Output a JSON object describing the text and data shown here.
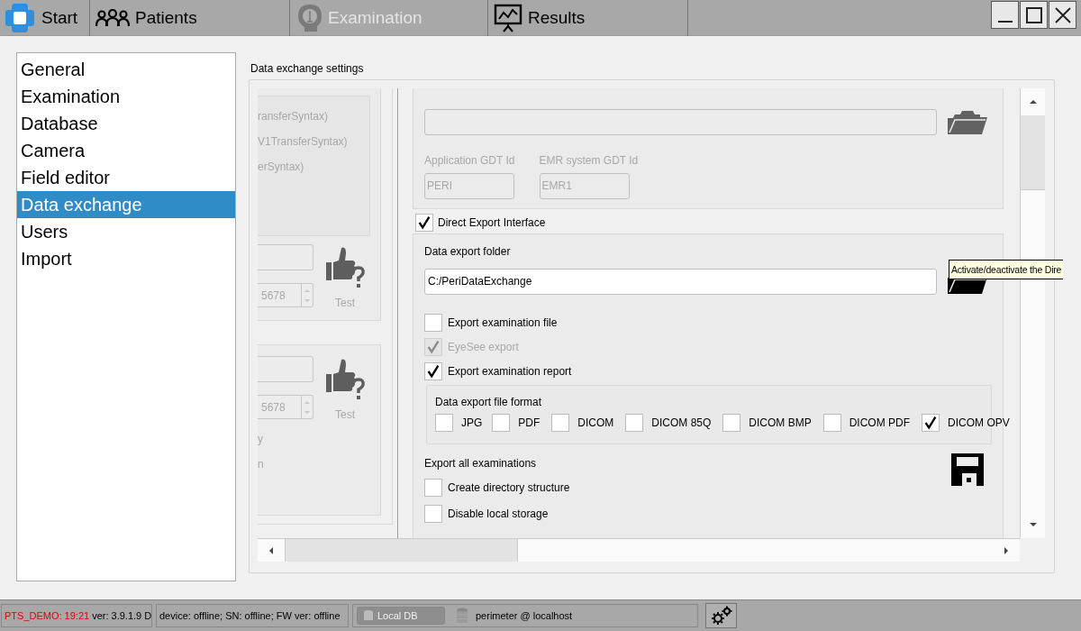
{
  "tabs": [
    {
      "label": "Start",
      "kind": "start",
      "disabled": false
    },
    {
      "label": "Patients",
      "kind": "patients",
      "disabled": false
    },
    {
      "label": "Examination",
      "kind": "examination",
      "disabled": true
    },
    {
      "label": "Results",
      "kind": "results",
      "disabled": false
    }
  ],
  "sidebar": {
    "items": [
      {
        "label": "General",
        "selected": false
      },
      {
        "label": "Examination",
        "selected": false
      },
      {
        "label": "Database",
        "selected": false
      },
      {
        "label": "Camera",
        "selected": false
      },
      {
        "label": "Field editor",
        "selected": false
      },
      {
        "label": "Data exchange",
        "selected": true
      },
      {
        "label": "Users",
        "selected": false
      },
      {
        "label": "Import",
        "selected": false
      }
    ]
  },
  "settings": {
    "title": "Data exchange settings",
    "left_panel": {
      "syntax_lines": [
        "ransferSyntax)",
        "V1TransferSyntax)",
        "erSyntax)"
      ],
      "connections": [
        {
          "port": "5678",
          "test": "Test"
        },
        {
          "port": "5678",
          "test": "Test",
          "extra": [
            "y",
            "n"
          ]
        }
      ]
    },
    "gdt": {
      "app_label": "Application GDT Id",
      "app_id": "PERI",
      "emr_label": "EMR system GDT Id",
      "emr_id": "EMR1"
    },
    "direct_export": {
      "label": "Direct Export Interface",
      "checked": true
    },
    "export_folder_label": "Data export folder",
    "export_folder": "C:/PeriDataExchange",
    "options": [
      {
        "label": "Export examination file",
        "checked": false,
        "disabled": false
      },
      {
        "label": "EyeSee export",
        "checked": true,
        "disabled": true
      },
      {
        "label": "Export examination report",
        "checked": true,
        "disabled": false
      }
    ],
    "format_group": {
      "title": "Data export file format",
      "formats": [
        {
          "label": "JPG",
          "checked": false
        },
        {
          "label": "PDF",
          "checked": false
        },
        {
          "label": "DICOM",
          "checked": false
        },
        {
          "label": "DICOM 85Q",
          "checked": false
        },
        {
          "label": "DICOM BMP",
          "checked": false
        },
        {
          "label": "DICOM PDF",
          "checked": false
        },
        {
          "label": "DICOM OPV",
          "checked": true
        }
      ]
    },
    "export_all": {
      "title": "Export all examinations",
      "options": [
        {
          "label": "Create directory structure",
          "checked": false
        },
        {
          "label": "Disable local storage",
          "checked": false
        }
      ]
    }
  },
  "tooltip": "Activate/deactivate the Dire",
  "status_bar": {
    "demo": "PTS_DEMO: 19:21",
    "version": "ver: 3.9.1.9 D",
    "device": "device: offline; SN: offline; FW ver: offline",
    "db_button": "Local DB",
    "connection": "perimeter @ localhost"
  }
}
